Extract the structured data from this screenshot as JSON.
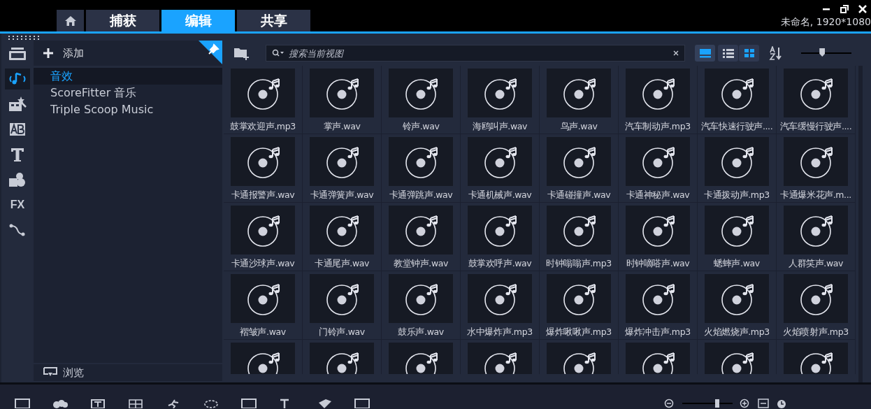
{
  "window": {
    "project_info": "未命名, 1920*1080"
  },
  "tabs": [
    {
      "kind": "home",
      "selected": false
    },
    {
      "kind": "text",
      "label": "捕获",
      "selected": false
    },
    {
      "kind": "text",
      "label": "编辑",
      "selected": true
    },
    {
      "kind": "text",
      "label": "共享",
      "selected": false
    }
  ],
  "sidebar": [
    {
      "kind": "media",
      "selected": false
    },
    {
      "kind": "audio",
      "selected": true
    },
    {
      "kind": "transition",
      "selected": false
    },
    {
      "kind": "title-ab",
      "selected": false
    },
    {
      "kind": "title-t",
      "selected": false
    },
    {
      "kind": "graphics",
      "selected": false
    },
    {
      "kind": "fx",
      "label": "FX",
      "selected": false
    },
    {
      "kind": "path",
      "selected": false
    }
  ],
  "library": {
    "add_label": "添加",
    "items": [
      {
        "label": "音效",
        "selected": true
      },
      {
        "label": "ScoreFitter 音乐",
        "selected": false
      },
      {
        "label": "Triple Scoop Music",
        "selected": false
      }
    ],
    "browse_label": "浏览"
  },
  "search": {
    "placeholder": "搜索当前视图"
  },
  "view_buttons": [
    {
      "kind": "titles",
      "selected": true
    },
    {
      "kind": "list",
      "selected": false
    },
    {
      "kind": "grid",
      "selected": true
    }
  ],
  "thumb_size_slider": {
    "level": 0.42
  },
  "files": [
    {
      "kind": "audio",
      "name": "鼓掌欢迎声.mp3"
    },
    {
      "kind": "audio",
      "name": "掌声.wav"
    },
    {
      "kind": "audio",
      "name": "铃声.wav"
    },
    {
      "kind": "audio",
      "name": "海鸥叫声.wav"
    },
    {
      "kind": "audio",
      "name": "鸟声.wav"
    },
    {
      "kind": "audio",
      "name": "汽车制动声.mp3"
    },
    {
      "kind": "audio",
      "name": "汽车快速行驶声...."
    },
    {
      "kind": "audio",
      "name": "汽车缓慢行驶声...."
    },
    {
      "kind": "audio",
      "name": "卡通报警声.wav"
    },
    {
      "kind": "audio",
      "name": "卡通弹簧声.wav"
    },
    {
      "kind": "audio",
      "name": "卡通弹跳声.wav"
    },
    {
      "kind": "audio",
      "name": "卡通机械声.wav"
    },
    {
      "kind": "audio",
      "name": "卡通碰撞声.wav"
    },
    {
      "kind": "audio",
      "name": "卡通神秘声.wav"
    },
    {
      "kind": "audio",
      "name": "卡通拨动声.mp3"
    },
    {
      "kind": "audio",
      "name": "卡通爆米花声.m..."
    },
    {
      "kind": "audio",
      "name": "卡通沙球声.wav"
    },
    {
      "kind": "audio",
      "name": "卡通尾声.wav"
    },
    {
      "kind": "audio",
      "name": "教堂钟声.wav"
    },
    {
      "kind": "audio",
      "name": "鼓掌欢呼声.wav"
    },
    {
      "kind": "audio",
      "name": "时钟嗡嗡声.mp3"
    },
    {
      "kind": "audio",
      "name": "时钟嘀嗒声.wav"
    },
    {
      "kind": "audio",
      "name": "蟋蟀声.wav"
    },
    {
      "kind": "audio",
      "name": "人群笑声.wav"
    },
    {
      "kind": "audio",
      "name": "褶皱声.wav"
    },
    {
      "kind": "audio",
      "name": "门铃声.wav"
    },
    {
      "kind": "audio",
      "name": "鼓乐声.wav"
    },
    {
      "kind": "audio",
      "name": "水中爆炸声.mp3"
    },
    {
      "kind": "audio",
      "name": "爆炸啾啾声.mp3"
    },
    {
      "kind": "audio",
      "name": "爆炸冲击声.mp3"
    },
    {
      "kind": "audio",
      "name": "火焰燃烧声.mp3"
    },
    {
      "kind": "audio",
      "name": "火焰喷射声.mp3"
    },
    {
      "kind": "audio"
    },
    {
      "kind": "audio"
    },
    {
      "kind": "audio"
    },
    {
      "kind": "audio"
    },
    {
      "kind": "audio"
    },
    {
      "kind": "audio"
    },
    {
      "kind": "audio"
    },
    {
      "kind": "audio"
    }
  ],
  "bottom_toolbar": [
    {
      "kind": "film"
    },
    {
      "kind": "circles"
    },
    {
      "kind": "title"
    },
    {
      "kind": "grid"
    },
    {
      "kind": "runner"
    },
    {
      "kind": "lasso"
    },
    {
      "kind": "frame"
    },
    {
      "kind": "title3d"
    },
    {
      "kind": "paint"
    },
    {
      "kind": "split"
    }
  ],
  "zoom_slider": {
    "level": 0.7
  }
}
